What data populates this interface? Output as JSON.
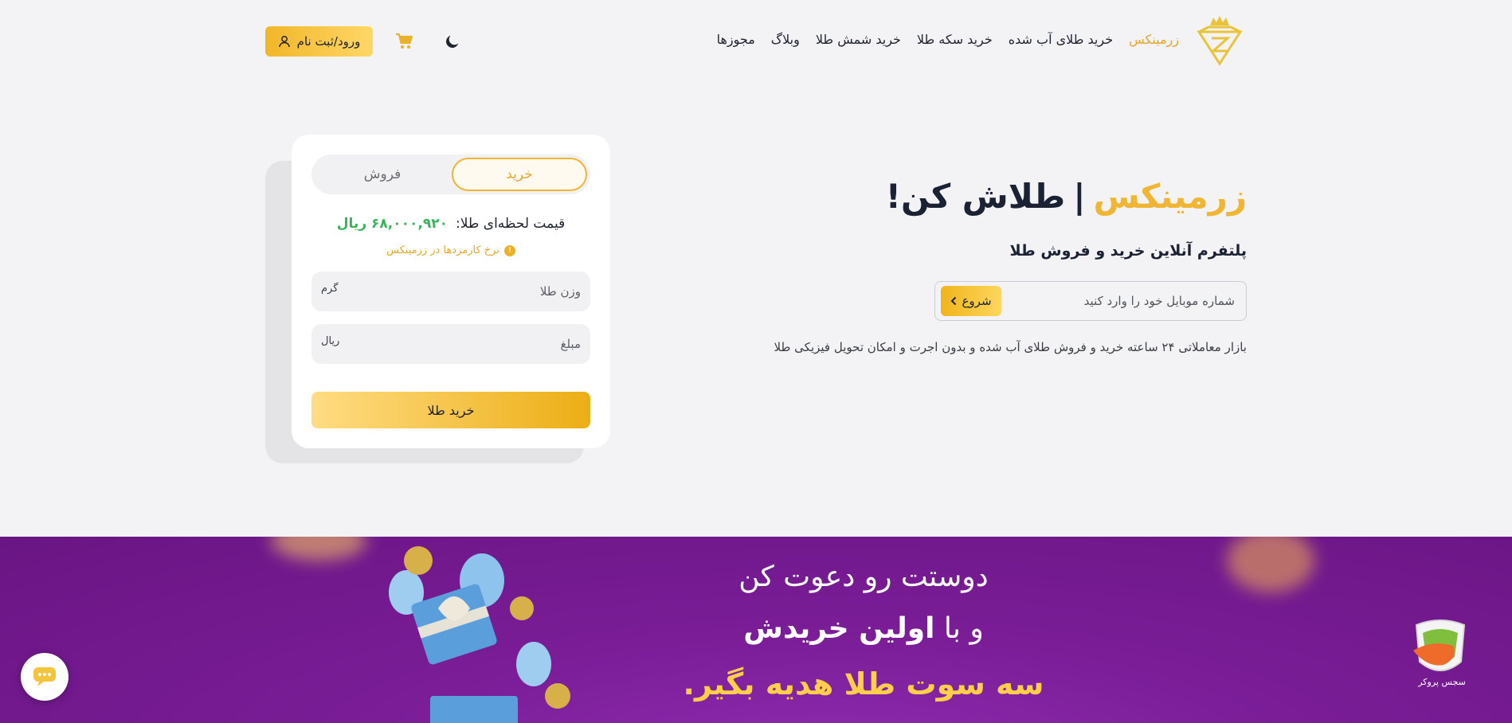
{
  "header": {
    "brand": "زرمینکس",
    "nav": [
      "زرمینکس",
      "خرید طلای آب شده",
      "خرید سکه طلا",
      "خرید شمش طلا",
      "وبلاگ",
      "مجوزها"
    ],
    "login_label": "ورود/ثبت نام",
    "icons": {
      "logo": "crown-diamond-logo",
      "theme": "moon-icon",
      "cart": "cart-icon",
      "user": "user-icon"
    },
    "colors": {
      "accent": "#f0b532",
      "button": "#f2b628"
    }
  },
  "hero": {
    "brand": "زرمینکس",
    "separator": "|",
    "slogan": "طلاش کن!",
    "subtitle": "پلتفرم آنلاین خرید و فروش طلا",
    "phone_placeholder": "شماره موبایل خود را وارد کنید",
    "start_label": "شروع",
    "description": "بازار معاملاتی ۲۴ ساعته خرید و فروش طلای آب شده و بدون اجرت و امکان تحویل فیزیکی طلا"
  },
  "trade": {
    "tab_buy": "خرید",
    "tab_sell": "فروش",
    "active_tab": "خرید",
    "price_label": "قیمت لحظه‌ای طلا:",
    "price_value": "۶۸,۰۰۰,۹۲۰ ریال",
    "fee_link": "نرخ کارمزدها در زرمینکس",
    "weight_placeholder": "وزن طلا",
    "weight_unit": "گرم",
    "amount_placeholder": "مبلغ",
    "amount_unit": "ریال",
    "submit_label": "خرید طلا",
    "colors": {
      "price": "#3ab45a",
      "fee": "#e4a72a"
    }
  },
  "banner": {
    "line1": "دوستت رو دعوت کن",
    "line2_prefix": "و با",
    "line2_bold": "اولین خریدش",
    "line3": "سه سوت طلا هدیه بگیر.",
    "badge_text": "سجس پروکر",
    "colors": {
      "background": "#7a1d97",
      "highlight": "#ffcf4a"
    }
  },
  "chat": {
    "icon": "chat-bubble-icon"
  }
}
